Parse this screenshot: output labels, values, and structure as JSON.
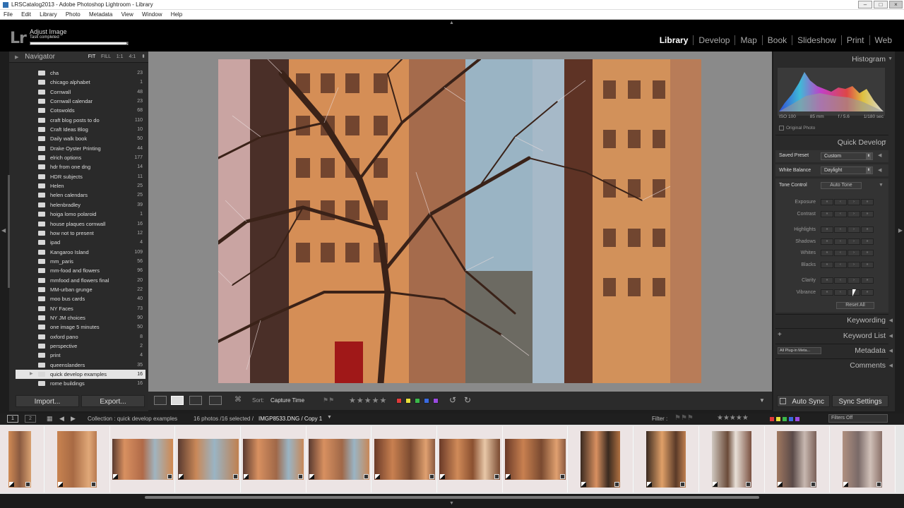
{
  "window": {
    "title": "LRSCatalog2013 - Adobe Photoshop Lightroom - Library",
    "menu": [
      "File",
      "Edit",
      "Library",
      "Photo",
      "Metadata",
      "View",
      "Window",
      "Help"
    ]
  },
  "identity": {
    "logo": "Lr",
    "task_title": "Adjust Image",
    "task_status": "Task completed",
    "close": "×",
    "modules": [
      "Library",
      "Develop",
      "Map",
      "Book",
      "Slideshow",
      "Print",
      "Web"
    ]
  },
  "navigator": {
    "title": "Navigator",
    "options": [
      "FIT",
      "FILL",
      "1:1",
      "4:1"
    ]
  },
  "collections": [
    {
      "name": "cha",
      "count": "23"
    },
    {
      "name": "chicago alphabet",
      "count": "1"
    },
    {
      "name": "Cornwall",
      "count": "48"
    },
    {
      "name": "Cornwall calendar",
      "count": "23"
    },
    {
      "name": "Cotswolds",
      "count": "68"
    },
    {
      "name": "craft blog posts to do",
      "count": "110"
    },
    {
      "name": "Craft Ideas Blog",
      "count": "10"
    },
    {
      "name": "Daily walk book",
      "count": "50"
    },
    {
      "name": "Drake Oyster Printing",
      "count": "44"
    },
    {
      "name": "elrich options",
      "count": "177"
    },
    {
      "name": "hdr from one dng",
      "count": "14"
    },
    {
      "name": "HDR subjects",
      "count": "11"
    },
    {
      "name": "Helen",
      "count": "25"
    },
    {
      "name": "helen calendars",
      "count": "25"
    },
    {
      "name": "helenbradley",
      "count": "39"
    },
    {
      "name": "hoiga lomo polaroid",
      "count": "1"
    },
    {
      "name": "house plaques cornwall",
      "count": "16"
    },
    {
      "name": "how not to present",
      "count": "12"
    },
    {
      "name": "ipad",
      "count": "4"
    },
    {
      "name": "Kangaroo Island",
      "count": "109"
    },
    {
      "name": "mm_paris",
      "count": "56"
    },
    {
      "name": "mm-food and flowers",
      "count": "96"
    },
    {
      "name": "mmfood and flowers final",
      "count": "20"
    },
    {
      "name": "MM-urban grunge",
      "count": "22"
    },
    {
      "name": "moo bus cards",
      "count": "40"
    },
    {
      "name": "NY Faces",
      "count": "73"
    },
    {
      "name": "NY JM choices",
      "count": "90"
    },
    {
      "name": "one image 5 minutes",
      "count": "50"
    },
    {
      "name": "oxford pano",
      "count": "8"
    },
    {
      "name": "perspective",
      "count": "2"
    },
    {
      "name": "print",
      "count": "4"
    },
    {
      "name": "queenslanders",
      "count": "35"
    },
    {
      "name": "quick develop examples",
      "count": "16",
      "selected": true
    },
    {
      "name": "rome buildings",
      "count": "16"
    }
  ],
  "left_buttons": {
    "import": "Import...",
    "export": "Export..."
  },
  "toolbar": {
    "sort_label": "Sort:",
    "sort_value": "Capture Time",
    "stars": "★★★★★",
    "colors": [
      "#e03a3a",
      "#e8e03a",
      "#3ab84a",
      "#3a6ae0",
      "#9a4ae0"
    ]
  },
  "histogram": {
    "title": "Histogram",
    "iso": "ISO 100",
    "focal": "85 mm",
    "aperture": "f / 5.6",
    "shutter": "1/180 sec",
    "original_photo": "Original Photo"
  },
  "quick_develop": {
    "title": "Quick Develop",
    "saved_preset_label": "Saved Preset",
    "saved_preset_value": "Custom",
    "white_balance_label": "White Balance",
    "white_balance_value": "Daylight",
    "tone_control_label": "Tone Control",
    "auto_tone": "Auto Tone",
    "adjustments": [
      "Exposure",
      "Contrast",
      "Highlights",
      "Shadows",
      "Whites",
      "Blacks",
      "Clarity",
      "Vibrance"
    ],
    "reset_all": "Reset All"
  },
  "right_panels": {
    "keywording": "Keywording",
    "keyword_list": "Keyword List",
    "keyword_plus": "+",
    "metadata": "Metadata",
    "metadata_select": "All Plug-in Meta...",
    "comments": "Comments"
  },
  "sync": {
    "auto_sync": "Auto Sync",
    "sync_settings": "Sync Settings"
  },
  "filmstrip_bar": {
    "page1": "1",
    "page2": "2",
    "path": "Collection : quick develop examples",
    "count": "16 photos /16 selected /",
    "file": "IMGP8533.DNG / Copy 1",
    "filter_label": "Filter :",
    "stars": "★★★★★",
    "filter_select": "Filters Off"
  }
}
